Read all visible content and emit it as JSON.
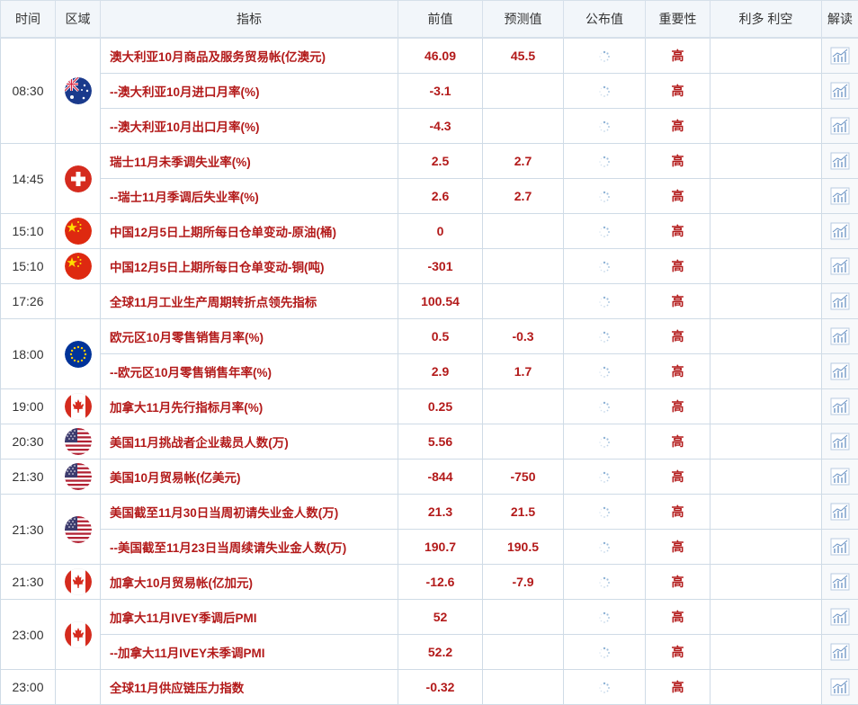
{
  "headers": [
    "时间",
    "区域",
    "指标",
    "前值",
    "预测值",
    "公布值",
    "重要性",
    "利多 利空",
    "解读"
  ],
  "groups": [
    {
      "time": "08:30",
      "flag": "australia",
      "rows": [
        {
          "indicator": "澳大利亚10月商品及服务贸易帐(亿澳元)",
          "prev": "46.09",
          "forecast": "45.5",
          "importance": "高"
        },
        {
          "indicator": "--澳大利亚10月进口月率(%)",
          "prev": "-3.1",
          "forecast": "",
          "importance": "高"
        },
        {
          "indicator": "--澳大利亚10月出口月率(%)",
          "prev": "-4.3",
          "forecast": "",
          "importance": "高"
        }
      ]
    },
    {
      "time": "14:45",
      "flag": "switzerland",
      "rows": [
        {
          "indicator": "瑞士11月未季调失业率(%)",
          "prev": "2.5",
          "forecast": "2.7",
          "importance": "高"
        },
        {
          "indicator": "--瑞士11月季调后失业率(%)",
          "prev": "2.6",
          "forecast": "2.7",
          "importance": "高"
        }
      ]
    },
    {
      "time": "15:10",
      "flag": "china",
      "rows": [
        {
          "indicator": "中国12月5日上期所每日仓单变动-原油(桶)",
          "prev": "0",
          "forecast": "",
          "importance": "高"
        }
      ]
    },
    {
      "time": "15:10",
      "flag": "china",
      "rows": [
        {
          "indicator": "中国12月5日上期所每日仓单变动-铜(吨)",
          "prev": "-301",
          "forecast": "",
          "importance": "高"
        }
      ]
    },
    {
      "time": "17:26",
      "flag": "",
      "rows": [
        {
          "indicator": "全球11月工业生产周期转折点领先指标",
          "prev": "100.54",
          "forecast": "",
          "importance": "高"
        }
      ]
    },
    {
      "time": "18:00",
      "flag": "eu",
      "rows": [
        {
          "indicator": "欧元区10月零售销售月率(%)",
          "prev": "0.5",
          "forecast": "-0.3",
          "importance": "高"
        },
        {
          "indicator": "--欧元区10月零售销售年率(%)",
          "prev": "2.9",
          "forecast": "1.7",
          "importance": "高"
        }
      ]
    },
    {
      "time": "19:00",
      "flag": "canada",
      "rows": [
        {
          "indicator": "加拿大11月先行指标月率(%)",
          "prev": "0.25",
          "forecast": "",
          "importance": "高"
        }
      ]
    },
    {
      "time": "20:30",
      "flag": "usa",
      "rows": [
        {
          "indicator": "美国11月挑战者企业裁员人数(万)",
          "prev": "5.56",
          "forecast": "",
          "importance": "高"
        }
      ]
    },
    {
      "time": "21:30",
      "flag": "usa",
      "rows": [
        {
          "indicator": "美国10月贸易帐(亿美元)",
          "prev": "-844",
          "forecast": "-750",
          "importance": "高"
        }
      ]
    },
    {
      "time": "21:30",
      "flag": "usa",
      "rows": [
        {
          "indicator": "美国截至11月30日当周初请失业金人数(万)",
          "prev": "21.3",
          "forecast": "21.5",
          "importance": "高"
        },
        {
          "indicator": "--美国截至11月23日当周续请失业金人数(万)",
          "prev": "190.7",
          "forecast": "190.5",
          "importance": "高"
        }
      ]
    },
    {
      "time": "21:30",
      "flag": "canada",
      "rows": [
        {
          "indicator": "加拿大10月贸易帐(亿加元)",
          "prev": "-12.6",
          "forecast": "-7.9",
          "importance": "高"
        }
      ]
    },
    {
      "time": "23:00",
      "flag": "canada",
      "rows": [
        {
          "indicator": "加拿大11月IVEY季调后PMI",
          "prev": "52",
          "forecast": "",
          "importance": "高"
        },
        {
          "indicator": "--加拿大11月IVEY未季调PMI",
          "prev": "52.2",
          "forecast": "",
          "importance": "高"
        }
      ]
    },
    {
      "time": "23:00",
      "flag": "",
      "rows": [
        {
          "indicator": "全球11月供应链压力指数",
          "prev": "-0.32",
          "forecast": "",
          "importance": "高"
        }
      ]
    }
  ],
  "colors": {
    "accent_red": "#b31a1a",
    "header_line": "#e03a3a",
    "border": "#cfdbe6",
    "header_bg": "#f2f6fa"
  }
}
